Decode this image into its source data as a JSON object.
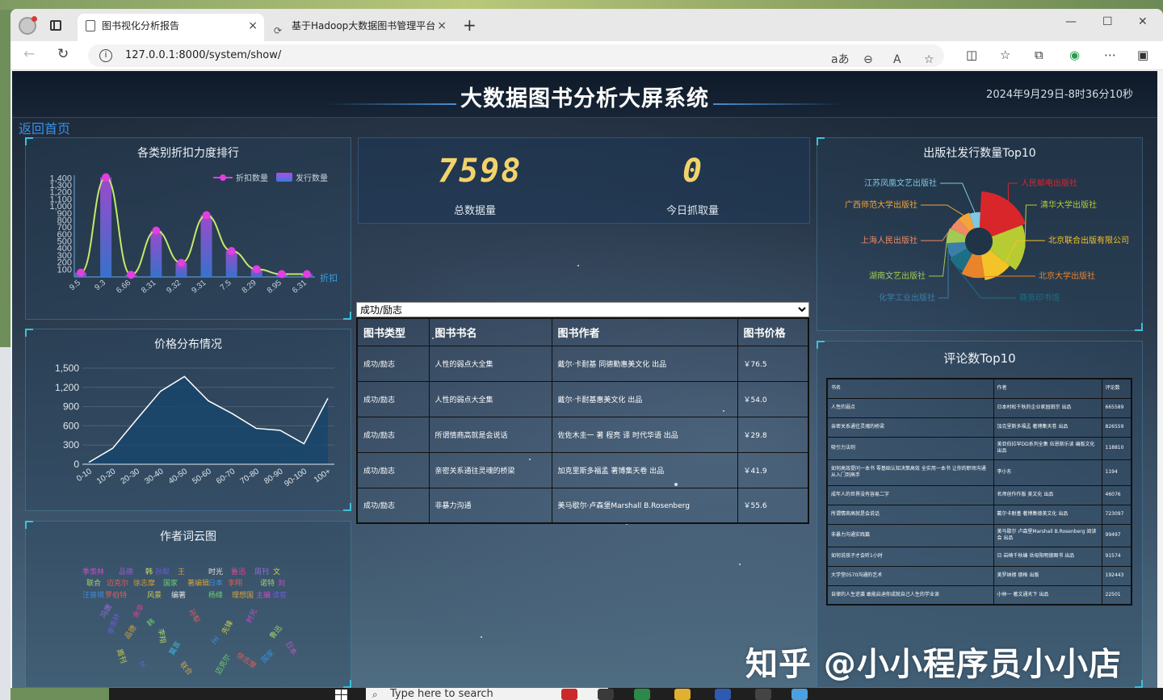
{
  "browser": {
    "tabs": [
      {
        "title": "图书视化分析报告",
        "active": true
      },
      {
        "title": "基于Hadoop大数据图书管理平台",
        "active": false
      }
    ],
    "url": "127.0.0.1:8000/system/show/",
    "tab_close_glyph": "×",
    "new_tab_glyph": "+"
  },
  "taskbar": {
    "search_placeholder": "Type here to search"
  },
  "header": {
    "title": "大数据图书分析大屏系统",
    "datetime": "2024年9月29日-8时36分10秒"
  },
  "back_link": "返回首页",
  "stats": {
    "total_value": "7598",
    "total_label": "总数据量",
    "today_value": "0",
    "today_label": "今日抓取量"
  },
  "type_select": {
    "selected": "成功/励志"
  },
  "book_table": {
    "headers": [
      "图书类型",
      "图书书名",
      "图书作者",
      "图书价格"
    ],
    "rows": [
      [
        "成功/励志",
        "人性的弱点大全集",
        "戴尔·卡耐基 同德勤惠美文化 出品",
        "￥76.5"
      ],
      [
        "成功/励志",
        "人性的弱点大全集",
        "戴尔·卡耐基惠美文化 出品",
        "￥54.0"
      ],
      [
        "成功/励志",
        "所谓情商高就是会说话",
        "佐佐木圭一 著 程亮 译 时代华语 出品",
        "￥29.8"
      ],
      [
        "成功/励志",
        "亲密关系通往灵魂的桥梁",
        "加克里斯多福孟 著博集天卷 出品",
        "￥41.9"
      ],
      [
        "成功/励志",
        "非暴力沟通",
        "美马歇尔·卢森堡Marshall B.Rosenberg",
        "￥55.6"
      ]
    ]
  },
  "charts": {
    "discount": {
      "title": "各类别折扣力度排行",
      "legend": [
        "折扣数量",
        "发行数量"
      ],
      "xlabel": "折扣"
    },
    "price": {
      "title": "价格分布情况"
    },
    "wordcloud": {
      "title": "作者词云图"
    },
    "publisher": {
      "title": "出版社发行数量Top10"
    },
    "comments": {
      "title": "评论数Top10"
    }
  },
  "chart_data": [
    {
      "type": "bar",
      "title": "各类别折扣力度排行",
      "categories": [
        "9.5",
        "9.3",
        "6.66",
        "8.31",
        "9.32",
        "9.31",
        "7.5",
        "8.29",
        "8.95",
        "6.31"
      ],
      "series": [
        {
          "name": "折扣数量",
          "values": [
            60,
            1420,
            30,
            660,
            200,
            880,
            370,
            110,
            40,
            40
          ]
        },
        {
          "name": "发行数量",
          "values": [
            60,
            1420,
            30,
            660,
            200,
            880,
            370,
            110,
            40,
            40
          ]
        }
      ],
      "ytick_labels": [
        "100",
        "200",
        "300",
        "400",
        "500",
        "600",
        "700",
        "800",
        "900",
        "1,000",
        "1,100",
        "1,200",
        "1,300",
        "1,400"
      ],
      "ylim": [
        0,
        1450
      ],
      "xlabel": "折扣"
    },
    {
      "type": "area",
      "title": "价格分布情况",
      "categories": [
        "0-10",
        "10-20",
        "20-30",
        "30-40",
        "40-50",
        "50-60",
        "60-70",
        "70-80",
        "80-90",
        "90-100",
        "100+"
      ],
      "values": [
        30,
        250,
        700,
        1140,
        1370,
        990,
        790,
        560,
        530,
        320,
        1030
      ],
      "ytick_labels": [
        "0",
        "300",
        "600",
        "900",
        "1,200",
        "1,500"
      ],
      "ylim": [
        0,
        1500
      ]
    },
    {
      "type": "pie",
      "title": "出版社发行数量Top10",
      "labels": [
        "人民邮电出版社",
        "清华大学出版社",
        "北京联合出版有限公司",
        "北京大学出版社",
        "商务印书馆",
        "化学工业出版社",
        "湖南文艺出版社",
        "上海人民出版社",
        "广西师范大学出版社",
        "江苏凤凰文艺出版社"
      ],
      "values": [
        170,
        150,
        110,
        95,
        80,
        70,
        70,
        60,
        60,
        55
      ],
      "colors": [
        "#d9262b",
        "#b6cc32",
        "#f4c327",
        "#e9842b",
        "#1d6f86",
        "#3a7fa8",
        "#a3c954",
        "#f08a62",
        "#f4a43a",
        "#7ec8e0"
      ]
    }
  ],
  "comments_table": {
    "headers": [
      "书名",
      "作者",
      "评论数"
    ],
    "rows": [
      [
        "人性的弱点",
        "日本村松千秋的企业家园田宗 出品",
        "665589"
      ],
      [
        "亲密关系通往灵魂的桥梁",
        "加克里斯多福孟 著博集天卷 出品",
        "826559"
      ],
      [
        "吸引力法则",
        "美亚伯拉罕DD系列全集 伍恩斯乐读 编版文化 出品",
        "118810"
      ],
      [
        "如何高效提问一本书 零基础认知决策高效 全实用一本书 让你的职场沟通从入门到高手",
        "李小东",
        "1194"
      ],
      [
        "成年人的世界没有容易二字",
        "名师创作作版 美文化 出品",
        "46076"
      ],
      [
        "所谓情商高就是会说话",
        "戴尔卡耐基 著博集德美文化 出品",
        "723097"
      ],
      [
        "非暴力沟通实践篇",
        "美马歇尔 卢森堡Marshall B.Rosenberg 阅读会 出品",
        "99497"
      ],
      [
        "如何说孩子才会听1小时",
        "日 岩崎千秋编 岳母阳明德图书 出品",
        "91574"
      ],
      [
        "大学堂0570沟通的艺术",
        "美罗纳德 德格 出版",
        "192443"
      ],
      [
        "自律的人生逆袭 敢能启迪你成就自己人生的学业读",
        "小林一 著文通天下 出品",
        "22501"
      ]
    ]
  },
  "wordcloud_words": [
    {
      "text": "季羡林",
      "color": "#c94dc9"
    },
    {
      "text": "品德",
      "color": "#9b59d0"
    },
    {
      "text": "韩",
      "color": "#cfd86a"
    },
    {
      "text": "孙犁",
      "color": "#6b5bd6"
    },
    {
      "text": "王",
      "color": "#d6a23a"
    },
    {
      "text": "时光",
      "color": "#e2e2e2"
    },
    {
      "text": "鲁迅",
      "color": "#e84393"
    },
    {
      "text": "周刊",
      "color": "#9c6be0"
    },
    {
      "text": "文",
      "color": "#d0d050"
    },
    {
      "text": "联合",
      "color": "#a8d06a"
    },
    {
      "text": "迈克尔",
      "color": "#e05d5d"
    },
    {
      "text": "徐志摩",
      "color": "#d09a3a"
    },
    {
      "text": "国家",
      "color": "#6bd06a"
    },
    {
      "text": "日本",
      "color": "#3f8fe0"
    },
    {
      "text": "李翔",
      "color": "#e05d5d"
    },
    {
      "text": "诺特",
      "color": "#a8d06a"
    },
    {
      "text": "刘",
      "color": "#c94dc9"
    },
    {
      "text": "著编辑",
      "color": "#d6a23a"
    },
    {
      "text": "汪曾祺",
      "color": "#3f8fe0"
    },
    {
      "text": "罗伯特",
      "color": "#e05d5d"
    },
    {
      "text": "风景",
      "color": "#d0d050"
    },
    {
      "text": "编著",
      "color": "#e2e2e2"
    },
    {
      "text": "杨绛",
      "color": "#6bd06a"
    },
    {
      "text": "理想国",
      "color": "#d6a23a"
    },
    {
      "text": "主编",
      "color": "#c94dc9"
    },
    {
      "text": "读客",
      "color": "#6b5bd6"
    },
    {
      "text": "冯唐",
      "color": "#9c6be0"
    },
    {
      "text": "余华",
      "color": "#e84393"
    },
    {
      "text": "先锋",
      "color": "#d0d050"
    },
    {
      "text": "莫言",
      "color": "#3fc0e0"
    }
  ],
  "watermark": "知乎 @小小程序员小小店"
}
